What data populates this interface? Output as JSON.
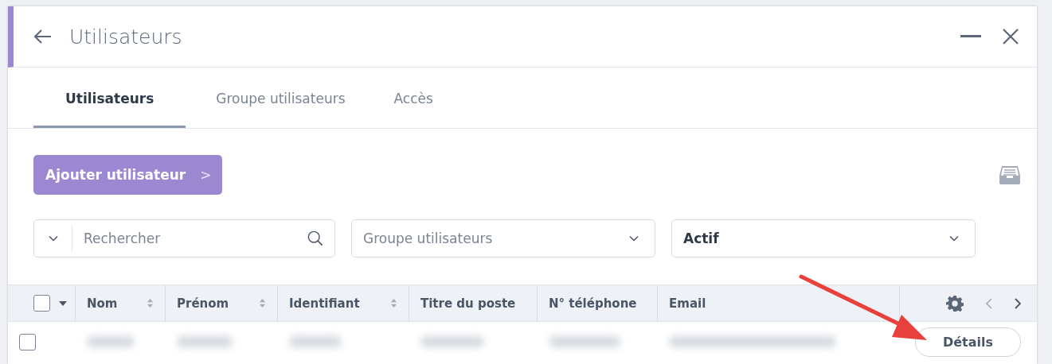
{
  "window": {
    "title": "Utilisateurs"
  },
  "tabs": [
    {
      "label": "Utilisateurs",
      "selected": true
    },
    {
      "label": "Groupe utilisateurs",
      "selected": false
    },
    {
      "label": "Accès",
      "selected": false
    }
  ],
  "add_button": {
    "label": "Ajouter utilisateur",
    "icon": ">"
  },
  "filters": {
    "search": {
      "placeholder": "Rechercher"
    },
    "group": {
      "placeholder": "Groupe utilisateurs"
    },
    "status": {
      "value": "Actif"
    }
  },
  "table": {
    "select_all": {
      "checked": false
    },
    "columns": [
      {
        "label": "Nom",
        "sortable": true
      },
      {
        "label": "Prénom",
        "sortable": true
      },
      {
        "label": "Identifiant",
        "sortable": true
      },
      {
        "label": "Titre du poste",
        "sortable": false
      },
      {
        "label": "N° téléphone",
        "sortable": false
      },
      {
        "label": "Email",
        "sortable": false
      }
    ],
    "rows": [
      {
        "checked": false,
        "action": "Détails"
      }
    ]
  },
  "annotation": {
    "kind": "arrow"
  }
}
